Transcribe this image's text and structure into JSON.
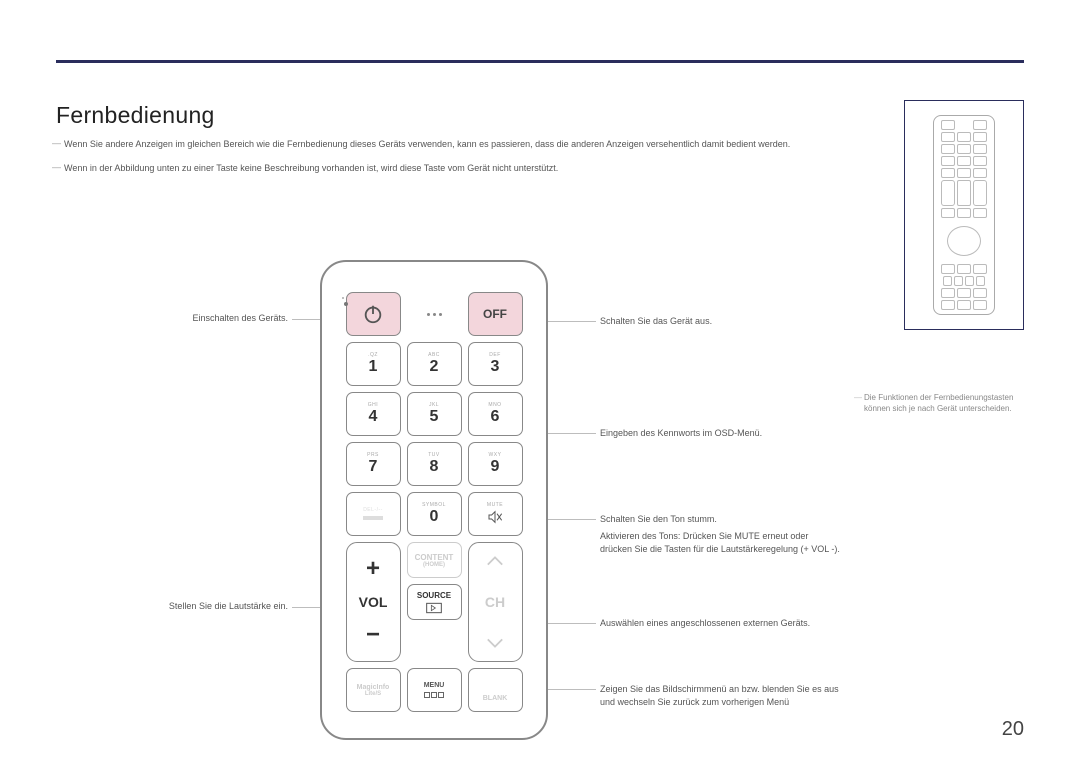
{
  "title": "Fernbedienung",
  "intro": {
    "p1": "Wenn Sie andere Anzeigen im gleichen Bereich wie die Fernbedienung dieses Geräts verwenden, kann es passieren, dass die anderen Anzeigen versehentlich damit bedient werden.",
    "p2": "Wenn in der Abbildung unten zu einer Taste keine Beschreibung vorhanden ist, wird diese Taste vom Gerät nicht unterstützt."
  },
  "buttons": {
    "off": "OFF",
    "k1_sub": ".QZ",
    "k1": "1",
    "k2_sub": "ABC",
    "k2": "2",
    "k3_sub": "DEF",
    "k3": "3",
    "k4_sub": "GHI",
    "k4": "4",
    "k5_sub": "JKL",
    "k5": "5",
    "k6_sub": "MNO",
    "k6": "6",
    "k7_sub": "PRS",
    "k7": "7",
    "k8_sub": "TUV",
    "k8": "8",
    "k9_sub": "WXY",
    "k9": "9",
    "del_sub": "DEL-/--",
    "sym_sub": "SYMBOL",
    "sym": "0",
    "mute_sub": "MUTE",
    "vol": "VOL",
    "ch": "CH",
    "content": "CONTENT",
    "home": "(HOME)",
    "source": "SOURCE",
    "magicinfo1": "MagicInfo",
    "magicinfo2": "Lite/S",
    "menu": "MENU",
    "blank": "BLANK"
  },
  "labels": {
    "power_on": "Einschalten des Geräts.",
    "power_off": "Schalten Sie das Gerät aus.",
    "keypad": "Eingeben des Kennworts im OSD-Menü.",
    "mute1": "Schalten Sie den Ton stumm.",
    "mute2": "Aktivieren des Tons: Drücken Sie MUTE erneut oder drücken Sie die Tasten für die Lautstärkeregelung (+ VOL -).",
    "vol": "Stellen Sie die Lautstärke ein.",
    "source": "Auswählen eines angeschlossenen externen Geräts.",
    "menu": "Zeigen Sie das Bildschirmmenü an bzw. blenden Sie es aus und wechseln Sie zurück zum vorherigen Menü"
  },
  "sidenote": "Die Funktionen der Fernbedienungstasten können sich je nach Gerät unterscheiden.",
  "pagenum": "20"
}
